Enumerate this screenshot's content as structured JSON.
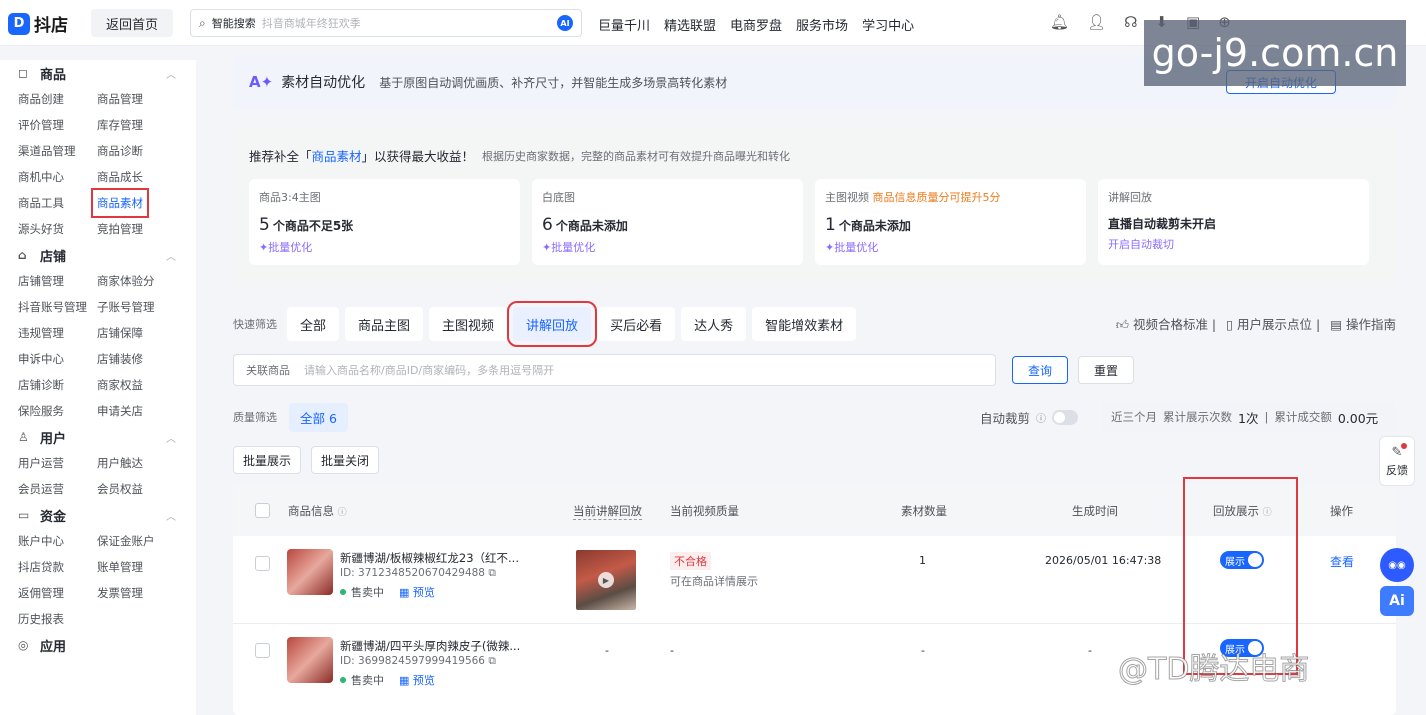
{
  "topbar": {
    "logo_glyph": "D",
    "logo_text": "抖店",
    "home_button": "返回首页",
    "search_label": "智能搜索",
    "search_placeholder": "抖音商城年终狂欢季",
    "search_ai_badge": "AI",
    "nav": [
      "巨量千川",
      "精选联盟",
      "电商罗盘",
      "服务市场",
      "学习中心"
    ],
    "icons": [
      "bell-icon",
      "user-icon",
      "headset-icon",
      "download-icon",
      "shop-icon",
      "plus-icon"
    ]
  },
  "sidebar": {
    "groups": [
      {
        "title": "商品",
        "icon": "box-icon",
        "items": [
          "商品创建",
          "商品管理",
          "评价管理",
          "库存管理",
          "渠道品管理",
          "商品诊断",
          "商机中心",
          "商品成长",
          "商品工具",
          "商品素材",
          "源头好货",
          "竞拍管理"
        ],
        "active": "商品素材"
      },
      {
        "title": "店铺",
        "icon": "store-icon",
        "items": [
          "店铺管理",
          "商家体验分",
          "抖音账号管理",
          "子账号管理",
          "违规管理",
          "店铺保障",
          "申诉中心",
          "店铺装修",
          "店铺诊断",
          "商家权益",
          "保险服务",
          "申请关店"
        ]
      },
      {
        "title": "用户",
        "icon": "users-icon",
        "items": [
          "用户运营",
          "用户触达",
          "会员运营",
          "会员权益"
        ]
      },
      {
        "title": "资金",
        "icon": "wallet-icon",
        "items": [
          "账户中心",
          "保证金账户",
          "抖店贷款",
          "账单管理",
          "返佣管理",
          "发票管理",
          "历史报表"
        ]
      },
      {
        "title": "应用",
        "icon": "app-icon",
        "items": []
      }
    ]
  },
  "banner": {
    "title": "素材自动优化",
    "desc": "基于原图自动调优画质、补齐尺寸，并智能生成多场景高转化素材",
    "button": "开启自动优化"
  },
  "recommend": {
    "title_prefix": "推荐补全「",
    "title_highlight": "商品素材",
    "title_suffix": "」以获得最大收益！",
    "desc": "根据历史商家数据，完整的商品素材可有效提升商品曝光和转化",
    "cards": [
      {
        "name": "商品3:4主图",
        "warn": "",
        "count": "5",
        "text": "个商品不足5张",
        "action": "✦批量优化"
      },
      {
        "name": "白底图",
        "warn": "",
        "count": "6",
        "text": "个商品未添加",
        "action": "✦批量优化"
      },
      {
        "name": "主图视频",
        "warn": "商品信息质量分可提升5分",
        "count": "1",
        "text": "个商品未添加",
        "action": "✦批量优化"
      },
      {
        "name": "讲解回放",
        "warn": "",
        "count": "",
        "text": "直播自动裁剪未开启",
        "action": "开启自动裁切"
      }
    ]
  },
  "filter": {
    "label": "快速筛选",
    "tabs": [
      "全部",
      "商品主图",
      "主图视频",
      "讲解回放",
      "买后必看",
      "达人秀",
      "智能增效素材"
    ],
    "active": "讲解回放",
    "links": [
      "视频合格标准 |",
      "用户展示点位 |",
      "操作指南"
    ]
  },
  "query": {
    "label": "关联商品",
    "placeholder": "请输入商品名称/商品ID/商家编码，多条用逗号隔开",
    "search_btn": "查询",
    "reset_btn": "重置"
  },
  "quality": {
    "label": "质量筛选",
    "all": "全部 6",
    "auto_cut": "自动裁剪",
    "stats_period": "近三个月",
    "stats_show_label": "累计展示次数",
    "stats_show_value": "1次",
    "stats_deal_label": "累计成交额",
    "stats_deal_value": "0.00元"
  },
  "batch": {
    "show": "批量展示",
    "close": "批量关闭"
  },
  "table": {
    "headers": [
      "商品信息",
      "当前讲解回放",
      "当前视频质量",
      "素材数量",
      "生成时间",
      "回放展示",
      "操作"
    ],
    "rows": [
      {
        "name": "新疆博湖/板椒辣椒红龙23（红不...",
        "id": "ID: 3712348520670429488",
        "status": "售卖中",
        "preview": "预览",
        "quality": "不合格",
        "quality_note": "可在商品详情展示",
        "count": "1",
        "time": "2026/05/01 16:47:38",
        "show": "展示",
        "action": "查看"
      },
      {
        "name": "新疆博湖/四平头厚肉辣皮子(微辣...",
        "id": "ID: 3699824597999419566",
        "status": "售卖中",
        "preview": "预览",
        "video": "-",
        "quality": "-",
        "count": "-",
        "time": "-",
        "show": "展示",
        "action": ""
      }
    ]
  },
  "float": {
    "feedback": "反馈",
    "ai": "Ai"
  },
  "watermarks": {
    "site": "go-j9.com.cn",
    "brand": "@TD腾达电商"
  }
}
